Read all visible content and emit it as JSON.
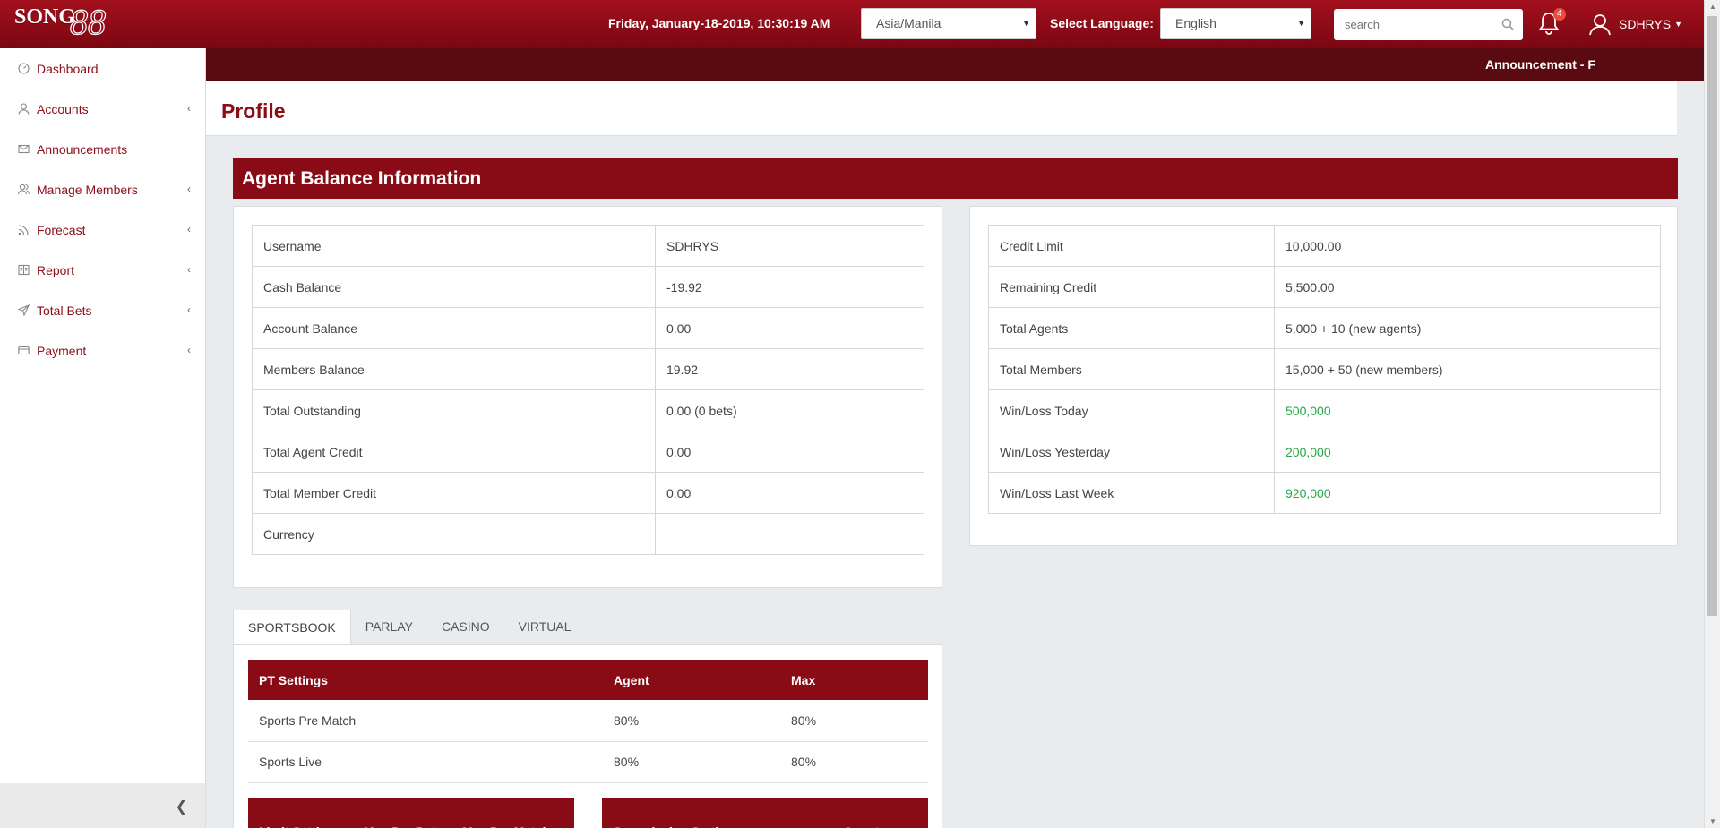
{
  "header": {
    "logo": "SONG88",
    "logo_main": "SONG",
    "logo_num": "88",
    "datetime": "Friday, January-18-2019, 10:30:19 AM",
    "timezone": "Asia/Manila",
    "language_label": "Select Language:",
    "language": "English",
    "search_placeholder": "search",
    "notifications_count": "4",
    "username": "SDHRYS"
  },
  "announcement": "Announcement - F",
  "sidebar": {
    "items": [
      {
        "label": "Dashboard",
        "icon": "dashboard-icon",
        "has_children": false
      },
      {
        "label": "Accounts",
        "icon": "user-icon",
        "has_children": true
      },
      {
        "label": "Announcements",
        "icon": "envelope-icon",
        "has_children": false
      },
      {
        "label": "Manage Members",
        "icon": "users-icon",
        "has_children": true
      },
      {
        "label": "Forecast",
        "icon": "rss-icon",
        "has_children": true
      },
      {
        "label": "Report",
        "icon": "book-icon",
        "has_children": true
      },
      {
        "label": "Total Bets",
        "icon": "paper-plane-icon",
        "has_children": true
      },
      {
        "label": "Payment",
        "icon": "credit-card-icon",
        "has_children": true
      }
    ]
  },
  "page_title": "Profile",
  "section_title": "Agent Balance Information",
  "left_table": [
    {
      "label": "Username",
      "value": "SDHRYS"
    },
    {
      "label": "Cash Balance",
      "value": "-19.92"
    },
    {
      "label": "Account Balance",
      "value": "0.00"
    },
    {
      "label": "Members Balance",
      "value": "19.92"
    },
    {
      "label": "Total Outstanding",
      "value": "0.00 (0 bets)"
    },
    {
      "label": "Total Agent Credit",
      "value": "0.00"
    },
    {
      "label": "Total Member Credit",
      "value": "0.00"
    },
    {
      "label": "Currency",
      "value": ""
    }
  ],
  "right_table": [
    {
      "label": "Credit Limit",
      "value": "10,000.00"
    },
    {
      "label": "Remaining Credit",
      "value": "5,500.00"
    },
    {
      "label": "Total Agents",
      "value": "5,000 + 10 (new agents)"
    },
    {
      "label": "Total Members",
      "value": "15,000 + 50 (new members)"
    },
    {
      "label": "Win/Loss Today",
      "value": "500,000"
    },
    {
      "label": "Win/Loss Yesterday",
      "value": "200,000"
    },
    {
      "label": "Win/Loss Last Week",
      "value": "920,000"
    }
  ],
  "positive_color": "#28a745",
  "accent_color": "#880b15",
  "tabs": [
    "SPORTSBOOK",
    "PARLAY",
    "CASINO",
    "VIRTUAL"
  ],
  "pt_settings": {
    "headers": [
      "PT Settings",
      "Agent",
      "Max"
    ],
    "rows": [
      [
        "Sports Pre Match",
        "80%",
        "80%"
      ],
      [
        "Sports Live",
        "80%",
        "80%"
      ]
    ]
  },
  "limit_settings": {
    "headers": [
      "Limit Settings",
      "Max Per Bet",
      "Max Per Match"
    ]
  },
  "commission_settings": {
    "headers": [
      "Commission Settings",
      "Agent"
    ]
  }
}
